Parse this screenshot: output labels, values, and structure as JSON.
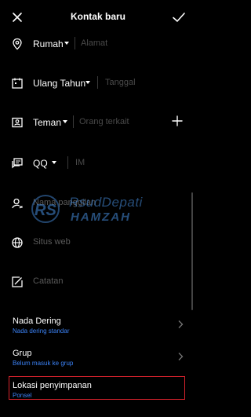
{
  "header": {
    "title": "Kontak baru",
    "close_icon": "close-icon",
    "save_icon": "check-icon"
  },
  "fields": {
    "address": {
      "type_label": "Rumah",
      "placeholder": "Alamat",
      "icon": "location-pin-icon"
    },
    "date": {
      "type_label": "Ulang Tahun",
      "placeholder": "Tanggal",
      "icon": "calendar-icon"
    },
    "relation": {
      "type_label": "Teman",
      "placeholder": "Orang terkait",
      "icon": "contact-card-icon"
    },
    "im": {
      "type_label": "QQ",
      "placeholder": "IM",
      "icon": "chat-icon"
    },
    "nickname": {
      "placeholder": "Nama panggilan",
      "icon": "person-icon"
    },
    "website": {
      "placeholder": "Situs web",
      "icon": "globe-icon"
    },
    "notes": {
      "placeholder": "Catatan",
      "icon": "note-icon"
    }
  },
  "settings": {
    "ringtone": {
      "title": "Nada Dering",
      "subtitle": "Nada dering standar"
    },
    "group": {
      "title": "Grup",
      "subtitle": "Belum masuk ke grup"
    },
    "storage": {
      "title": "Lokasi penyimpanan",
      "subtitle": "Ponsel"
    }
  },
  "watermark": {
    "line1": "RsudDepati",
    "line2": "HAMZAH"
  },
  "colors": {
    "background": "#000000",
    "accent": "#3b82f6",
    "highlight": "#d9232d",
    "placeholder": "#4a4a4a"
  }
}
